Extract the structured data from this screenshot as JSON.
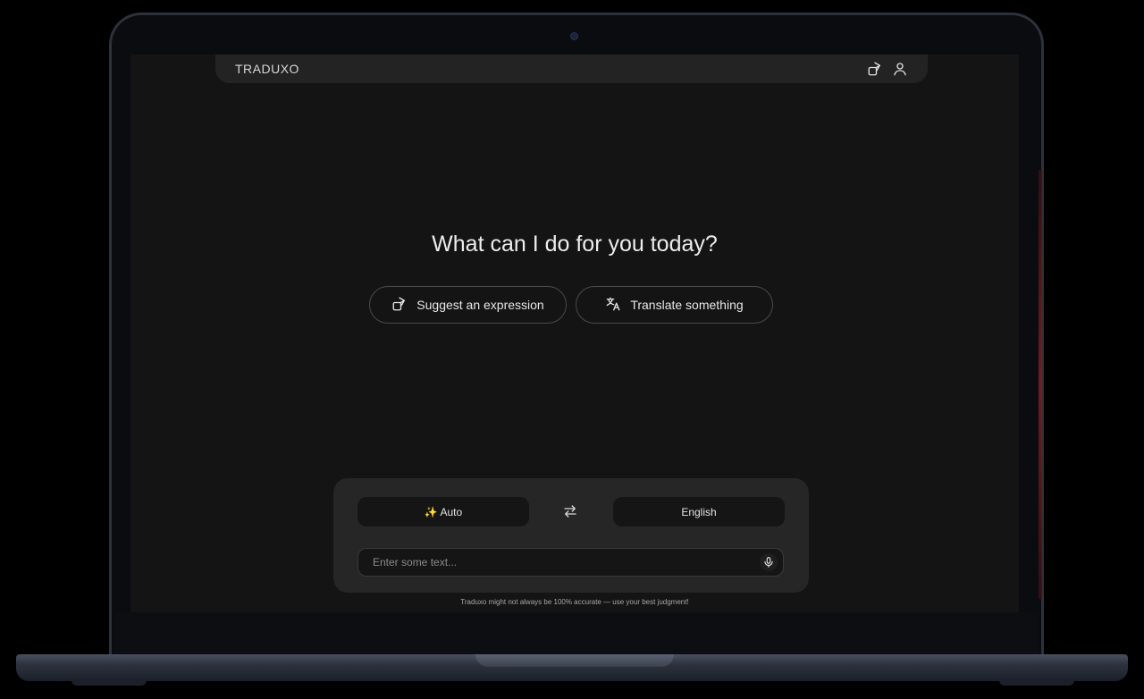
{
  "app": {
    "brand": "TRADUXO"
  },
  "header": {
    "icons": [
      "suggest-icon",
      "user-icon"
    ]
  },
  "main": {
    "headline": "What can I do for you today?",
    "actions": [
      {
        "label": "Suggest an expression",
        "icon": "suggest-icon"
      },
      {
        "label": "Translate something",
        "icon": "translate-icon"
      }
    ]
  },
  "translator": {
    "source_language": "✨ Auto",
    "target_language": "English",
    "swap_icon": "swap-icon",
    "input_placeholder": "Enter some text...",
    "input_value": "",
    "mic_icon": "microphone-icon"
  },
  "footer": {
    "disclaimer": "Traduxo might not always be 100% accurate — use your best judgment!"
  },
  "colors": {
    "background": "#141414",
    "panel": "#262626",
    "field": "#151515",
    "text": "#ededed"
  }
}
